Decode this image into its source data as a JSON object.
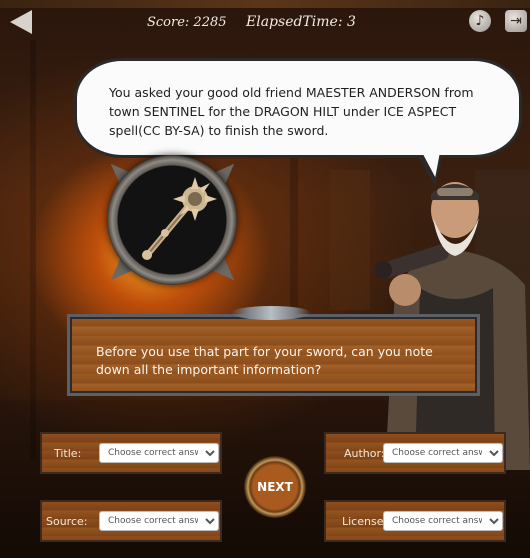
{
  "header": {
    "score_text": "Score: 2285",
    "elapsed_text": "ElapsedTime: 3",
    "back_icon": "back-arrow-icon",
    "music_icon": "music-note-icon",
    "exit_icon": "exit-door-icon"
  },
  "dialogue": {
    "text": "You asked your good old friend MAESTER ANDERSON from town SENTINEL for the DRAGON HILT under ICE ASPECT spell(CC BY-SA) to finish the sword."
  },
  "item": {
    "icon": "mace-hilt-icon"
  },
  "question": {
    "text": "Before you use that part for your sword, can you note down all the important information?"
  },
  "fields": {
    "title": {
      "label": "Title:",
      "selected": "Choose correct answer"
    },
    "author": {
      "label": "Author:",
      "selected": "Choose correct answer"
    },
    "source": {
      "label": "Source:",
      "selected": "Choose correct answer"
    },
    "license": {
      "label": "License:",
      "selected": "Choose correct answer"
    }
  },
  "buttons": {
    "next_label": "NEXT"
  },
  "colors": {
    "panel_wood": "#8e501d",
    "bubble_bg": "#fbfbfb",
    "forge_glow": "#ffaa28"
  }
}
